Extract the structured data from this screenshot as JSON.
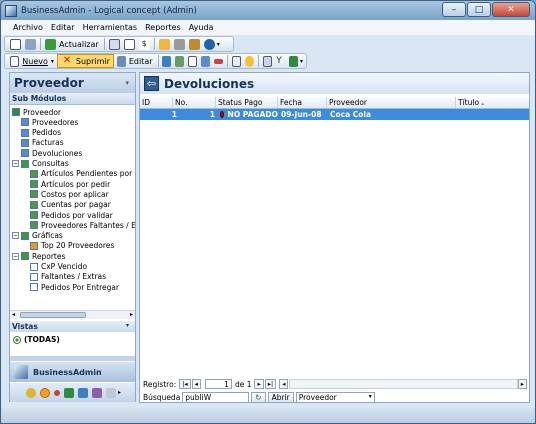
{
  "window": {
    "title": "BusinessAdmin - Logical concept (Admin)"
  },
  "menu": [
    "Archivo",
    "Editar",
    "Herramientas",
    "Reportes",
    "Ayuda"
  ],
  "toolbar1": {
    "update_label": "Actualizar"
  },
  "toolbar2": {
    "new_label": "Nuevo",
    "delete_label": "Suprimir",
    "edit_label": "Editar"
  },
  "left": {
    "header": "Proveedor",
    "submodules_label": "Sub Módulos",
    "tree": [
      {
        "label": "Proveedor",
        "level": 0,
        "kind": "root"
      },
      {
        "label": "Proveedores",
        "level": 1,
        "kind": "item"
      },
      {
        "label": "Pedidos",
        "level": 1,
        "kind": "item"
      },
      {
        "label": "Facturas",
        "level": 1,
        "kind": "item"
      },
      {
        "label": "Devoluciones",
        "level": 1,
        "kind": "item"
      },
      {
        "label": "Consultas",
        "level": 0,
        "kind": "group"
      },
      {
        "label": "Artículos Pendientes por S",
        "level": 2,
        "kind": "query"
      },
      {
        "label": "Artículos por pedir",
        "level": 2,
        "kind": "query"
      },
      {
        "label": "Costos por aplicar",
        "level": 2,
        "kind": "query"
      },
      {
        "label": "Cuentas por pagar",
        "level": 2,
        "kind": "query"
      },
      {
        "label": "Pedidos por validar",
        "level": 2,
        "kind": "query"
      },
      {
        "label": "Proveedores Faltantes / Ex",
        "level": 2,
        "kind": "query"
      },
      {
        "label": "Gráficas",
        "level": 0,
        "kind": "group"
      },
      {
        "label": "Top 20 Proveedores",
        "level": 2,
        "kind": "chart"
      },
      {
        "label": "Reportes",
        "level": 0,
        "kind": "group"
      },
      {
        "label": "CxP Vencido",
        "level": 2,
        "kind": "report"
      },
      {
        "label": "Faltantes / Extras",
        "level": 2,
        "kind": "report"
      },
      {
        "label": "Pedidos Por Entregar",
        "level": 2,
        "kind": "report"
      }
    ],
    "views_label": "Vistas",
    "all_view": "(TODAS)",
    "brand": "BusinessAdmin"
  },
  "main": {
    "title": "Devoluciones",
    "columns": [
      "ID",
      "No.",
      "Status Pago",
      "Fecha",
      "Proveedor",
      "Título"
    ],
    "rows": [
      {
        "id": "1",
        "no": "1",
        "status": "NO PAGADO",
        "fecha": "09-Jun-08",
        "proveedor": "Coca Cola",
        "titulo": ""
      }
    ]
  },
  "nav": {
    "label": "Registro:",
    "current": "1",
    "of_label": "de 1"
  },
  "search": {
    "label": "Búsqueda",
    "value": "publiW",
    "open_label": "Abrir",
    "field": "Proveedor"
  },
  "colors": {
    "selection": "#3d8bdd",
    "header_text": "#14325a"
  }
}
